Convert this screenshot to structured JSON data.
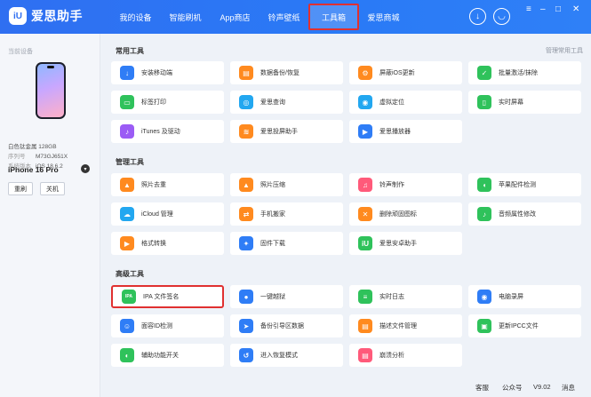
{
  "app": {
    "logo_mark": "iU",
    "title": "爱思助手"
  },
  "nav": [
    "我的设备",
    "智能刷机",
    "App商店",
    "铃声壁纸",
    "工具箱",
    "爱思商城"
  ],
  "nav_active": "工具箱",
  "header_icons": [
    "download-icon",
    "user-icon"
  ],
  "window_controls": [
    "menu-icon",
    "minimize-icon",
    "maximize-icon",
    "close-icon"
  ],
  "sidebar": {
    "caption": "当前设备",
    "device_name": "iPhone 16 Pro",
    "spec": "白色钛金属 128GB",
    "serial_key": "序列号",
    "serial_value": "M73GJ651X",
    "system_key": "系统版本",
    "system_value": "iOS 18.6.2",
    "refresh": "重刷",
    "shutdown": "关机"
  },
  "main": {
    "manage_link": "管理常用工具",
    "sections": [
      {
        "title": "常用工具",
        "tools": [
          {
            "label": "安装移动端",
            "icon": "phone-install-icon",
            "color": "#2f7df6",
            "glyph": "↓"
          },
          {
            "label": "数据备份/恢复",
            "icon": "backup-icon",
            "color": "#ff8a1f",
            "glyph": "▤"
          },
          {
            "label": "屏蔽iOS更新",
            "icon": "gear-icon",
            "color": "#ff8a1f",
            "glyph": "⚙"
          },
          {
            "label": "批量激活/抹除",
            "icon": "shield-check-icon",
            "color": "#2fc25b",
            "glyph": "✓"
          },
          {
            "label": "标签打印",
            "icon": "printer-icon",
            "color": "#2fc25b",
            "glyph": "▭"
          },
          {
            "label": "爱思查询",
            "icon": "search-icon",
            "color": "#22a7f0",
            "glyph": "◎"
          },
          {
            "label": "虚拟定位",
            "icon": "location-icon",
            "color": "#22a7f0",
            "glyph": "◉"
          },
          {
            "label": "实时屏幕",
            "icon": "screen-icon",
            "color": "#2fc25b",
            "glyph": "▯"
          },
          {
            "label": "iTunes 及驱动",
            "icon": "music-icon",
            "color": "#9b5cf5",
            "glyph": "♪"
          },
          {
            "label": "爱思投屏助手",
            "icon": "wifi-cast-icon",
            "color": "#ff8a1f",
            "glyph": "≋"
          },
          {
            "label": "爱思播放器",
            "icon": "video-icon",
            "color": "#2f7df6",
            "glyph": "▶"
          }
        ]
      },
      {
        "title": "管理工具",
        "tools": [
          {
            "label": "照片去重",
            "icon": "photo-icon",
            "color": "#ff8a1f",
            "glyph": "▲"
          },
          {
            "label": "照片压缩",
            "icon": "photo-compress-icon",
            "color": "#ff8a1f",
            "glyph": "▲"
          },
          {
            "label": "铃声制作",
            "icon": "bell-icon",
            "color": "#ff5a7a",
            "glyph": "♫"
          },
          {
            "label": "苹果配件检测",
            "icon": "earbuds-icon",
            "color": "#2fc25b",
            "glyph": "◖"
          },
          {
            "label": "iCloud 管理",
            "icon": "cloud-icon",
            "color": "#22a7f0",
            "glyph": "☁"
          },
          {
            "label": "手机搬家",
            "icon": "transfer-icon",
            "color": "#ff8a1f",
            "glyph": "⇄"
          },
          {
            "label": "删除顽固图标",
            "icon": "trash-icon",
            "color": "#ff8a1f",
            "glyph": "✕"
          },
          {
            "label": "音频属性修改",
            "icon": "audio-edit-icon",
            "color": "#2fc25b",
            "glyph": "♪"
          },
          {
            "label": "格式转换",
            "icon": "convert-icon",
            "color": "#ff8a1f",
            "glyph": "▶"
          },
          {
            "label": "固件下载",
            "icon": "firmware-download-icon",
            "color": "#2f7df6",
            "glyph": "✦"
          },
          {
            "label": "爱思安卓助手",
            "icon": "android-helper-icon",
            "color": "#2fc25b",
            "glyph": "iU"
          }
        ]
      },
      {
        "title": "高级工具",
        "tools": [
          {
            "label": "IPA 文件签名",
            "icon": "ipa-icon",
            "color": "#2fc25b",
            "glyph": "IPA"
          },
          {
            "label": "一键越狱",
            "icon": "apple-icon",
            "color": "#2f7df6",
            "glyph": "●"
          },
          {
            "label": "实时日志",
            "icon": "log-icon",
            "color": "#2fc25b",
            "glyph": "≡"
          },
          {
            "label": "电脑录屏",
            "icon": "record-icon",
            "color": "#2f7df6",
            "glyph": "◉"
          },
          {
            "label": "面容ID检测",
            "icon": "face-id-icon",
            "color": "#2f7df6",
            "glyph": "☺"
          },
          {
            "label": "备份引导区数据",
            "icon": "send-icon",
            "color": "#2f7df6",
            "glyph": "➤"
          },
          {
            "label": "描述文件管理",
            "icon": "profile-icon",
            "color": "#ff8a1f",
            "glyph": "▤"
          },
          {
            "label": "更新IPCC文件",
            "icon": "ipcc-icon",
            "color": "#2fc25b",
            "glyph": "▣"
          },
          {
            "label": "辅助功能开关",
            "icon": "toggle-icon",
            "color": "#2fc25b",
            "glyph": "◐"
          },
          {
            "label": "进入恢复模式",
            "icon": "restore-icon",
            "color": "#2f7df6",
            "glyph": "↺"
          },
          {
            "label": "崩溃分析",
            "icon": "crash-icon",
            "color": "#ff5a7a",
            "glyph": "▤"
          }
        ]
      }
    ]
  },
  "footer": {
    "feedback": "客服",
    "wechat": "公众号",
    "version": "V9.02",
    "messages": "消息"
  }
}
